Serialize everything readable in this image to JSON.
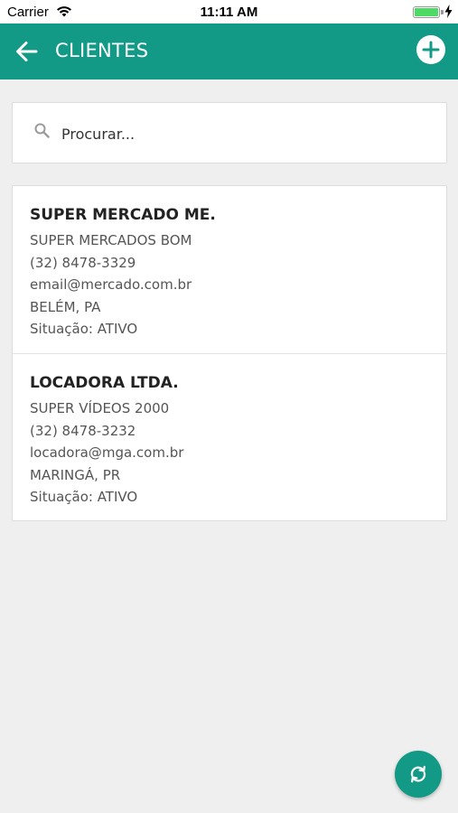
{
  "status_bar": {
    "carrier": "Carrier",
    "time": "11:11 AM"
  },
  "app_bar": {
    "title": "CLIENTES"
  },
  "search": {
    "placeholder": "Procurar..."
  },
  "clients": [
    {
      "name": "SUPER MERCADO ME.",
      "trade_name": "SUPER MERCADOS BOM",
      "phone": "(32) 8478-3329",
      "email": "email@mercado.com.br",
      "city": "BELÉM, PA",
      "status": "Situação:  ATIVO"
    },
    {
      "name": "LOCADORA LTDA.",
      "trade_name": "SUPER VÍDEOS 2000",
      "phone": "(32) 8478-3232",
      "email": "locadora@mga.com.br",
      "city": "MARINGÁ, PR",
      "status": "Situação:  ATIVO"
    }
  ],
  "colors": {
    "primary": "#139a86",
    "background": "#efefef",
    "battery": "#4cd964"
  },
  "icons": {
    "back": "arrow-left-icon",
    "add": "plus-circle-icon",
    "search": "magnifier-icon",
    "sync": "sync-icon"
  }
}
